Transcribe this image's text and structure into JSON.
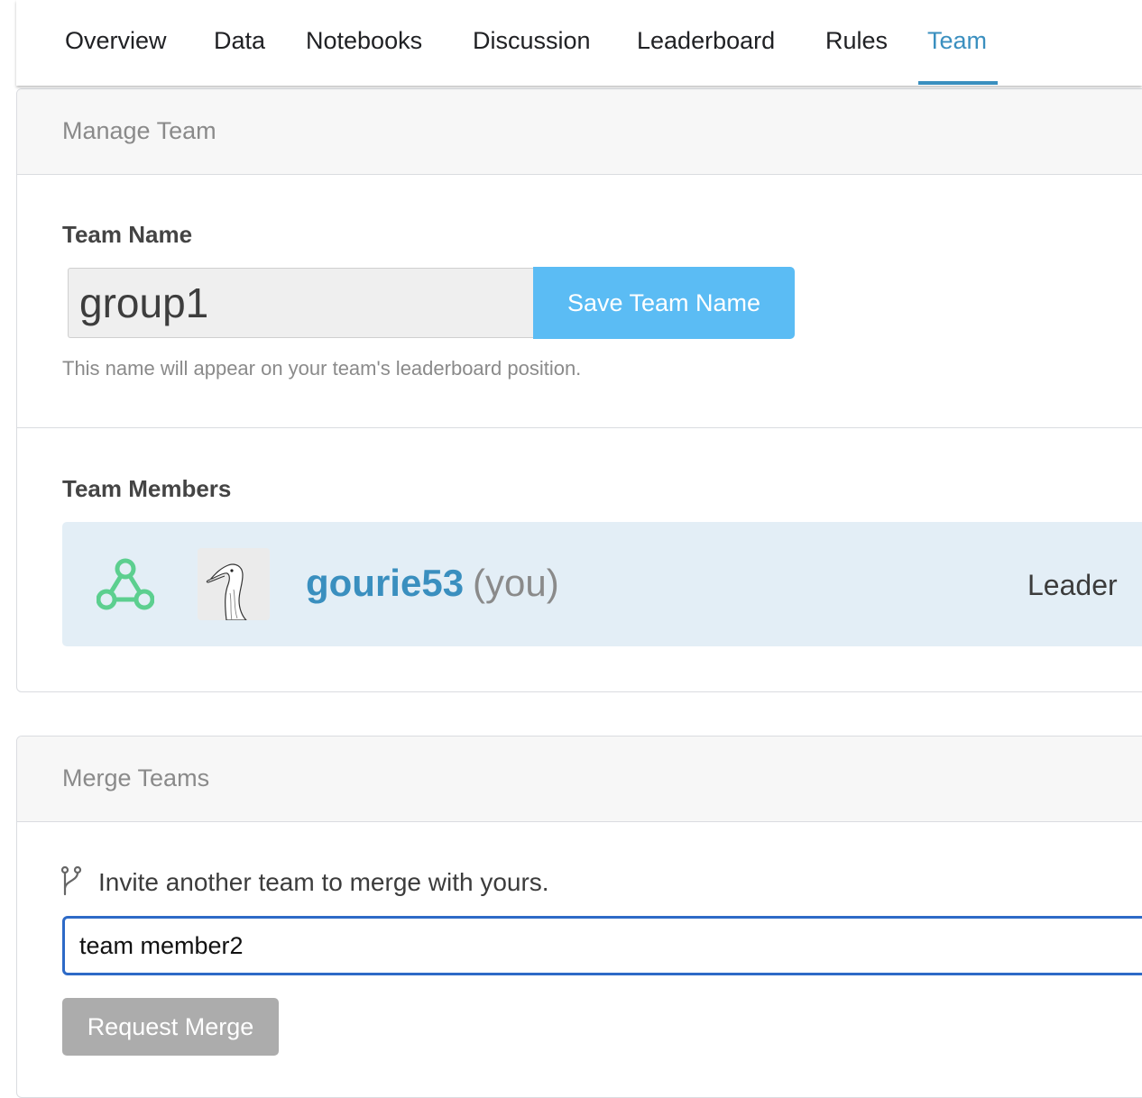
{
  "tabs": [
    {
      "label": "Overview",
      "active": false
    },
    {
      "label": "Data",
      "active": false
    },
    {
      "label": "Notebooks",
      "active": false
    },
    {
      "label": "Discussion",
      "active": false
    },
    {
      "label": "Leaderboard",
      "active": false
    },
    {
      "label": "Rules",
      "active": false
    },
    {
      "label": "Team",
      "active": true
    }
  ],
  "manage_team": {
    "header": "Manage Team",
    "team_name_label": "Team Name",
    "team_name_value": "group1",
    "save_button": "Save Team Name",
    "hint": "This name will appear on your team's leaderboard position.",
    "members_label": "Team Members",
    "members": [
      {
        "username": "gourie53",
        "self_marker": "(you)",
        "role": "Leader",
        "tier_icon": "contributor-tier-icon",
        "avatar_icon": "goose-avatar"
      }
    ]
  },
  "merge_teams": {
    "header": "Merge Teams",
    "invite_label": "Invite another team to merge with yours.",
    "invite_icon": "merge-icon",
    "input_value": "team member2",
    "request_button": "Request Merge"
  },
  "colors": {
    "accent": "#3a8fbf",
    "save_button": "#5bbcf4",
    "member_row_bg": "#e3eef6",
    "disabled_button": "#acacac",
    "focus_border": "#2d6ac7",
    "tier_green": "#5ccf8f"
  }
}
